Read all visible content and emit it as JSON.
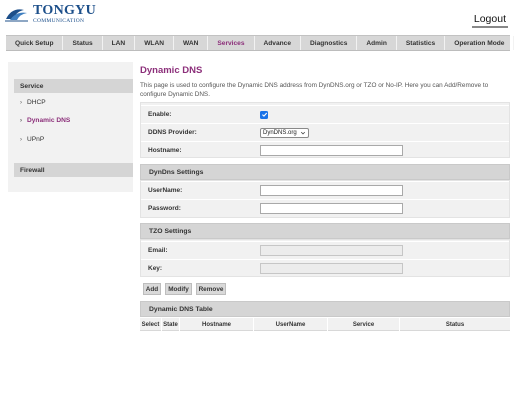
{
  "brand": {
    "name": "TONGYU",
    "sub": "COMMUNICATION"
  },
  "header": {
    "logout_label": "Logout"
  },
  "nav": {
    "items": [
      {
        "label": "Quick Setup",
        "active": false
      },
      {
        "label": "Status",
        "active": false
      },
      {
        "label": "LAN",
        "active": false
      },
      {
        "label": "WLAN",
        "active": false
      },
      {
        "label": "WAN",
        "active": false
      },
      {
        "label": "Services",
        "active": true
      },
      {
        "label": "Advance",
        "active": false
      },
      {
        "label": "Diagnostics",
        "active": false
      },
      {
        "label": "Admin",
        "active": false
      },
      {
        "label": "Statistics",
        "active": false
      },
      {
        "label": "Operation Mode",
        "active": false
      }
    ]
  },
  "sidebar": {
    "service_header": "Service",
    "items": [
      {
        "label": "DHCP",
        "active": false
      },
      {
        "label": "Dynamic DNS",
        "active": true
      },
      {
        "label": "UPnP",
        "active": false
      }
    ],
    "firewall_header": "Firewall"
  },
  "page": {
    "title": "Dynamic DNS",
    "description": "This page is used to configure the Dynamic DNS address from DynDNS.org or TZO or No-IP. Here you can Add/Remove to configure Dynamic DNS."
  },
  "form": {
    "enable_label": "Enable:",
    "enable_checked": true,
    "provider_label": "DDNS Provider:",
    "provider_value": "DynDNS.org",
    "hostname_label": "Hostname:",
    "hostname_value": ""
  },
  "dyndns": {
    "header": "DynDns Settings",
    "username_label": "UserName:",
    "username_value": "",
    "password_label": "Password:",
    "password_value": ""
  },
  "tzo": {
    "header": "TZO Settings",
    "email_label": "Email:",
    "email_value": "",
    "key_label": "Key:",
    "key_value": ""
  },
  "buttons": {
    "add": "Add",
    "modify": "Modify",
    "remove": "Remove"
  },
  "table": {
    "header": "Dynamic DNS Table",
    "columns": [
      "Select",
      "State",
      "Hostname",
      "UserName",
      "Service",
      "Status"
    ]
  },
  "colors": {
    "accent": "#8c2f7a",
    "brand": "#1c4f8a",
    "checkbox": "#1a73e8"
  }
}
